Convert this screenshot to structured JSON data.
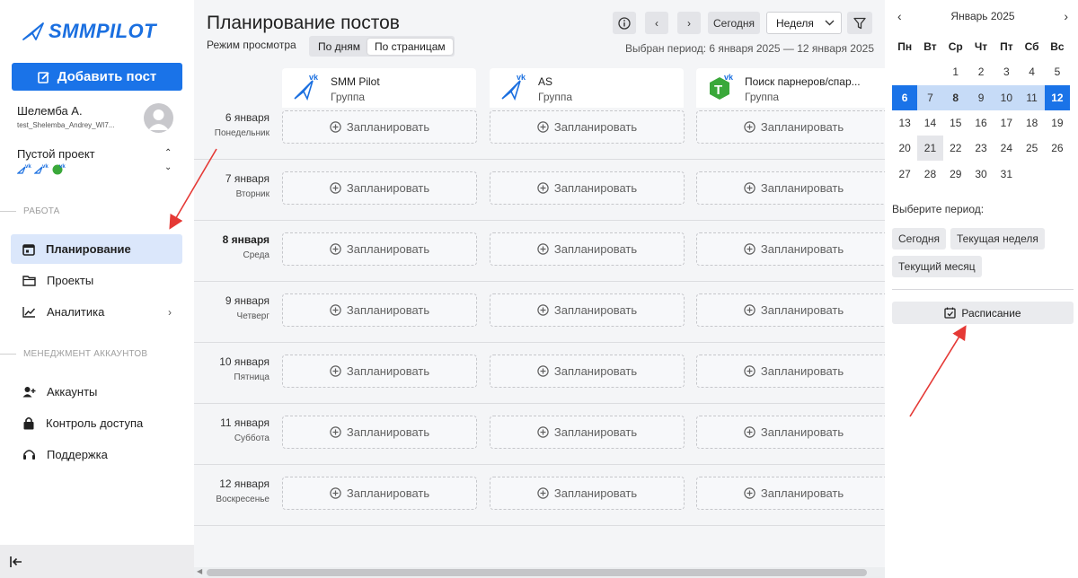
{
  "sidebar": {
    "logo_text": "SMMPILOT",
    "add_post_label": "Добавить пост",
    "user_name": "Шелемба А.",
    "user_login": "test_Shelemba_Andrey_WI7...",
    "project_name": "Пустой проект",
    "sections": {
      "work": "РАБОТА",
      "accounts": "МЕНЕДЖМЕНТ АККАУНТОВ"
    },
    "items": [
      {
        "label": "Планирование",
        "icon": "calendar-icon",
        "active": true
      },
      {
        "label": "Проекты",
        "icon": "folder-icon"
      },
      {
        "label": "Аналитика",
        "icon": "chart-line-icon"
      },
      {
        "label": "Аккаунты",
        "icon": "add-user-icon"
      },
      {
        "label": "Контроль доступа",
        "icon": "lock-icon"
      },
      {
        "label": "Поддержка",
        "icon": "headset-icon"
      }
    ]
  },
  "main": {
    "title": "Планирование постов",
    "mode_label": "Режим просмотра",
    "modes": [
      "По дням",
      "По страницам"
    ],
    "selected_mode": "По страницам",
    "today_button": "Сегодня",
    "range_select": "Неделя",
    "period_text": "Выбран период: 6 января 2025 — 12 января 2025",
    "pages": [
      {
        "name": "SMM Pilot",
        "type": "Группа"
      },
      {
        "name": "AS",
        "type": "Группа"
      },
      {
        "name": "Поиск парнеров/спар...",
        "type": "Группа"
      }
    ],
    "plan_label": "Запланировать",
    "days": [
      {
        "date": "6 января",
        "weekday": "Понедельник",
        "bold": false
      },
      {
        "date": "7 января",
        "weekday": "Вторник",
        "bold": false
      },
      {
        "date": "8 января",
        "weekday": "Среда",
        "bold": true
      },
      {
        "date": "9 января",
        "weekday": "Четверг",
        "bold": false
      },
      {
        "date": "10 января",
        "weekday": "Пятница",
        "bold": false
      },
      {
        "date": "11 января",
        "weekday": "Суббота",
        "bold": false
      },
      {
        "date": "12 января",
        "weekday": "Воскресенье",
        "bold": false
      }
    ]
  },
  "calendar": {
    "month_title": "Январь 2025",
    "weekdays": [
      "Пн",
      "Вт",
      "Ср",
      "Чт",
      "Пт",
      "Сб",
      "Вс"
    ],
    "weeks": [
      [
        "",
        "",
        "1",
        "2",
        "3",
        "4",
        "5"
      ],
      [
        "6",
        "7",
        "8",
        "9",
        "10",
        "11",
        "12"
      ],
      [
        "13",
        "14",
        "15",
        "16",
        "17",
        "18",
        "19"
      ],
      [
        "20",
        "21",
        "22",
        "23",
        "24",
        "25",
        "26"
      ],
      [
        "27",
        "28",
        "29",
        "30",
        "31",
        "",
        ""
      ]
    ],
    "selected_start": "6",
    "selected_end": "12",
    "today": "8",
    "highlighted": "21",
    "period_label": "Выберите период:",
    "chips": [
      "Сегодня",
      "Текущая неделя",
      "Текущий месяц"
    ],
    "schedule_button": "Расписание"
  },
  "colors": {
    "accent": "#1a73e8",
    "range": "#c6dbf7",
    "active_nav": "#dbe7fb",
    "annotation_arrow": "#e53935"
  }
}
